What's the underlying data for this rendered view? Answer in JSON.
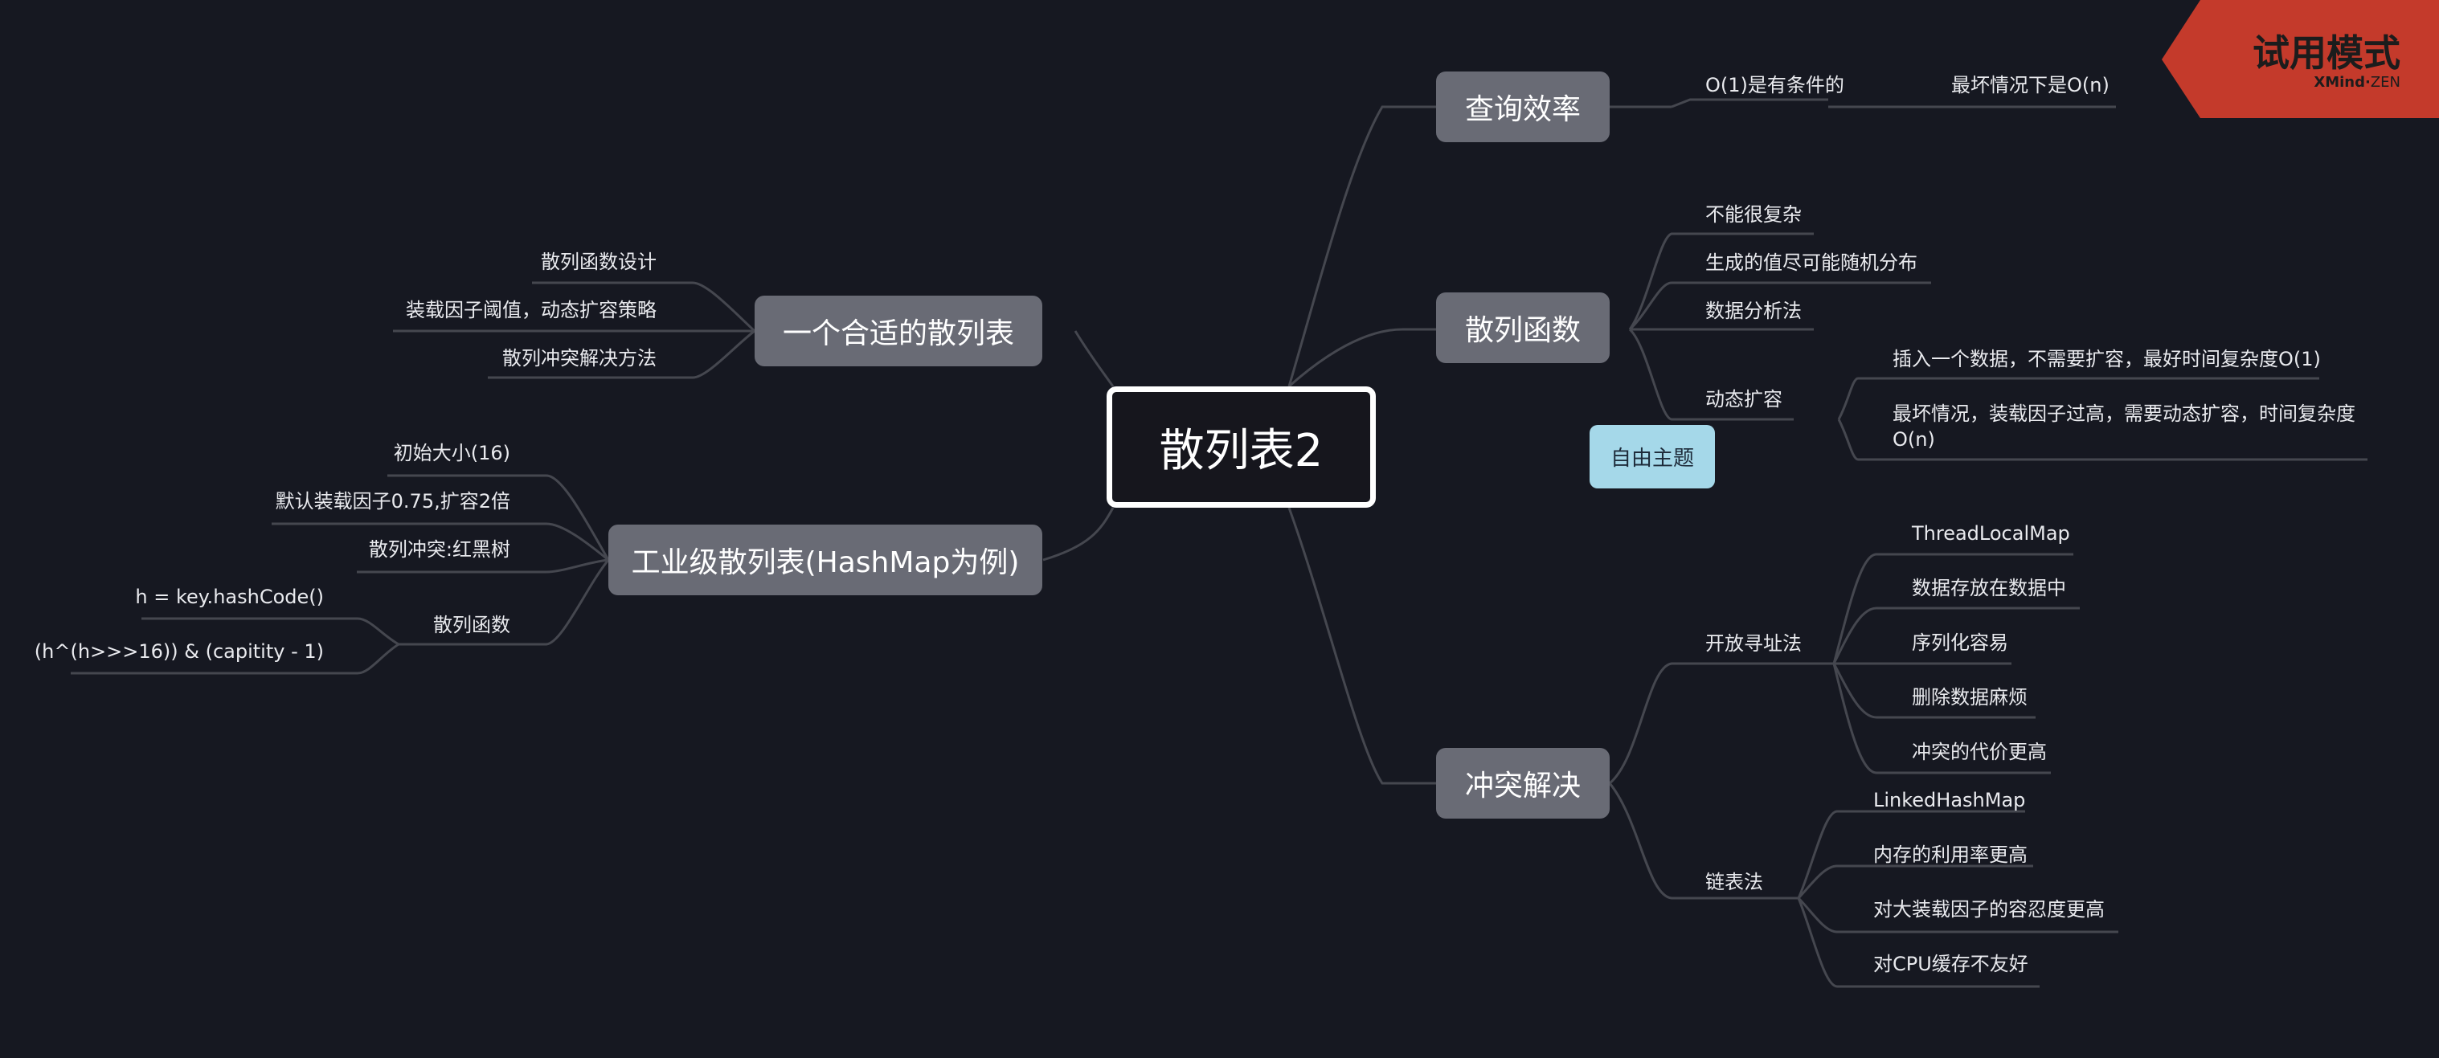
{
  "central_topic": "散列表2",
  "free_topic": "自由主题",
  "trial_badge": {
    "title": "试用模式",
    "brand": "XMind",
    "edition": "ZEN"
  },
  "right_branches": {
    "query_efficiency": {
      "label": "查询效率",
      "children": [
        "O(1)是有条件的",
        "最坏情况下是O(n)"
      ]
    },
    "hash_function": {
      "label": "散列函数",
      "children": [
        "不能很复杂",
        "生成的值尽可能随机分布",
        "数据分析法",
        "动态扩容"
      ],
      "dynamic_expansion_children": [
        "插入一个数据，不需要扩容，最好时间复杂度O(1)",
        "最坏情况，装载因子过高，需要动态扩容，时间复杂度",
        "O(n)"
      ]
    },
    "conflict_resolution": {
      "label": "冲突解决",
      "open_addressing": {
        "label": "开放寻址法",
        "children": [
          "ThreadLocalMap",
          "数据存放在数据中",
          "序列化容易",
          "删除数据麻烦",
          "冲突的代价更高"
        ]
      },
      "chaining": {
        "label": "链表法",
        "children": [
          "LinkedHashMap",
          "内存的利用率更高",
          "对大装载因子的容忍度更高",
          "对CPU缓存不友好"
        ]
      }
    }
  },
  "left_branches": {
    "suitable_hash_table": {
      "label": "一个合适的散列表",
      "children": [
        "散列函数设计",
        "装载因子阈值，动态扩容策略",
        "散列冲突解决方法"
      ]
    },
    "industrial_hash_table": {
      "label": "工业级散列表(HashMap为例)",
      "children": [
        "初始大小(16)",
        "默认装载因子0.75,扩容2倍",
        "散列冲突:红黑树",
        "散列函数"
      ],
      "hash_function_children": [
        "h = key.hashCode()",
        "(h^(h>>>16)) & (capitity - 1)"
      ]
    }
  }
}
